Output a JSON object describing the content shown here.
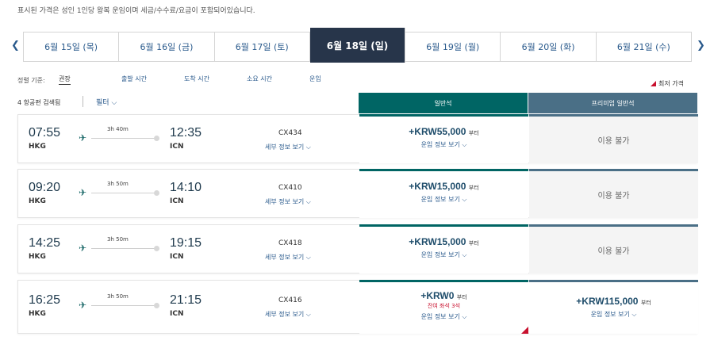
{
  "notice": "표시된 가격은 성인 1인당 왕복 운임이며 세금/수수료/요금이 포함되어있습니다.",
  "nav": {
    "prev_icon": "chevron-left-icon",
    "next_icon": "chevron-right-icon"
  },
  "dates": [
    {
      "label": "6월 15일 (목)"
    },
    {
      "label": "6월 16일 (금)"
    },
    {
      "label": "6월 17일 (토)"
    },
    {
      "label": "6월 18일 (일)",
      "active": true
    },
    {
      "label": "6월 19일 (월)"
    },
    {
      "label": "6월 20일 (화)"
    },
    {
      "label": "6월 21일 (수)"
    }
  ],
  "sort": {
    "label": "정렬 기준:",
    "options": [
      "권장",
      "출발 시간",
      "도착 시간",
      "소요 시간",
      "운임"
    ],
    "selected": "권장"
  },
  "lowest_fare_label": "최저 가격",
  "flight_count": "4 항공편 검색됨",
  "filter_label": "필터",
  "columns": {
    "economy": "일반석",
    "premium": "프리미엄 일반석"
  },
  "flights": [
    {
      "dep_time": "07:55",
      "dep_code": "HKG",
      "arr_time": "12:35",
      "arr_code": "ICN",
      "duration": "3h 40m",
      "flight_no": "CX434",
      "details": "세부 정보 보기",
      "economy": {
        "price": "+KRW55,000",
        "from": "부터",
        "info": "운임 정보 보기"
      },
      "premium": {
        "unavailable": "이용 불가"
      }
    },
    {
      "dep_time": "09:20",
      "dep_code": "HKG",
      "arr_time": "14:10",
      "arr_code": "ICN",
      "duration": "3h 50m",
      "flight_no": "CX410",
      "details": "세부 정보 보기",
      "economy": {
        "price": "+KRW15,000",
        "from": "부터",
        "info": "운임 정보 보기"
      },
      "premium": {
        "unavailable": "이용 불가"
      }
    },
    {
      "dep_time": "14:25",
      "dep_code": "HKG",
      "arr_time": "19:15",
      "arr_code": "ICN",
      "duration": "3h 50m",
      "flight_no": "CX418",
      "details": "세부 정보 보기",
      "economy": {
        "price": "+KRW15,000",
        "from": "부터",
        "info": "운임 정보 보기"
      },
      "premium": {
        "unavailable": "이용 불가"
      }
    },
    {
      "dep_time": "16:25",
      "dep_code": "HKG",
      "arr_time": "21:15",
      "arr_code": "ICN",
      "duration": "3h 50m",
      "flight_no": "CX416",
      "details": "세부 정보 보기",
      "economy": {
        "price": "+KRW0",
        "from": "부터",
        "seats": "잔여 좌석 3석",
        "info": "운임 정보 보기"
      },
      "premium": {
        "price": "+KRW115,000",
        "from": "부터",
        "info": "운임 정보 보기"
      }
    }
  ],
  "colors": {
    "economy": "#006564",
    "premium": "#4a6f86",
    "active_date": "#27354a",
    "accent_red": "#c8102e"
  }
}
